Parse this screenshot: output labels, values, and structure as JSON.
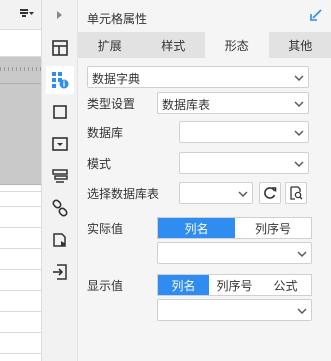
{
  "panel": {
    "title": "单元格属性"
  },
  "tabs": [
    {
      "label": "扩展"
    },
    {
      "label": "样式"
    },
    {
      "label": "形态"
    },
    {
      "label": "其他"
    }
  ],
  "form": {
    "type_select": {
      "value": "数据字典"
    },
    "type_setting": {
      "label": "类型设置",
      "value": "数据库表"
    },
    "database": {
      "label": "数据库",
      "value": ""
    },
    "schema": {
      "label": "模式",
      "value": ""
    },
    "select_table": {
      "label": "选择数据库表",
      "value": ""
    },
    "actual_value": {
      "label": "实际值",
      "options": [
        {
          "label": "列名",
          "active": true
        },
        {
          "label": "列序号",
          "active": false
        }
      ],
      "column_value": ""
    },
    "display_value": {
      "label": "显示值",
      "options": [
        {
          "label": "列名",
          "active": true
        },
        {
          "label": "列序号",
          "active": false
        },
        {
          "label": "公式",
          "active": false
        }
      ],
      "column_value": ""
    }
  },
  "toolbar_icons": [
    "cell-element-icon",
    "cell-attribute-icon",
    "widget-settings-icon",
    "condition-attribute-icon",
    "hyperlink-icon",
    "floating-element-icon",
    "data-filter-icon",
    "data-import-icon"
  ],
  "colors": {
    "accent": "#2f8cf0",
    "panel_bg": "#f5f5f5",
    "tab_bg": "#e2e2e2",
    "icon": "#333333",
    "active_icon": "#2f8cf0"
  }
}
